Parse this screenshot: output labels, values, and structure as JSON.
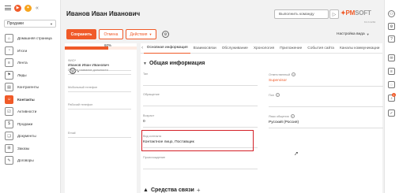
{
  "sidebar": {
    "workspace": "Продажи",
    "items": [
      {
        "label": "Домашняя страница",
        "icon": "home-icon",
        "glyph": "⌂"
      },
      {
        "label": "Итоги",
        "icon": "chart-icon",
        "glyph": "◔"
      },
      {
        "label": "Лента",
        "icon": "feed-icon",
        "glyph": "≡"
      },
      {
        "label": "Лиды",
        "icon": "lead-icon",
        "glyph": "⚑"
      },
      {
        "label": "Контрагенты",
        "icon": "accounts-icon",
        "glyph": "▤"
      },
      {
        "label": "Контакты",
        "icon": "contacts-icon",
        "glyph": "☺"
      },
      {
        "label": "Активности",
        "icon": "activities-icon",
        "glyph": "☑"
      },
      {
        "label": "Продажи",
        "icon": "sales-icon",
        "glyph": "$"
      },
      {
        "label": "Документы",
        "icon": "documents-icon",
        "glyph": "❑"
      },
      {
        "label": "Заказы",
        "icon": "orders-icon",
        "glyph": "⊞"
      },
      {
        "label": "Договоры",
        "icon": "contracts-icon",
        "glyph": "✎"
      }
    ],
    "active_index": 5
  },
  "header": {
    "title": "Иванов Иван Иванович",
    "command_placeholder": "Выполнить команду",
    "logo_a": "✦",
    "logo_b": "PM",
    "logo_c": "SOFT",
    "version": "8.0.6.3284"
  },
  "toolbar": {
    "save": "Сохранить",
    "cancel": "Отмена",
    "actions": "Действия",
    "view_settings": "Настройка вида"
  },
  "profile": {
    "completeness_value": 0.6,
    "completeness_label": "60%",
    "fields": [
      {
        "label": "ФИО*",
        "value": "Иванов Иван Иванович"
      },
      {
        "label": "Полное название должности",
        "value": ""
      },
      {
        "label": "Мобильный телефон",
        "value": ""
      },
      {
        "label": "Рабочий телефон",
        "value": ""
      },
      {
        "label": "Email",
        "value": ""
      }
    ]
  },
  "tabs": [
    "Основная информация",
    "Взаимосвязи",
    "Обслуживание",
    "Хронология",
    "Приложение",
    "События сайта",
    "Каналы коммуникации"
  ],
  "tabs_active": 0,
  "section_main": {
    "title": "Общая информация",
    "fields_left": [
      {
        "label": "Тип",
        "value": ""
      },
      {
        "label": "Обращение",
        "value": ""
      },
      {
        "label": "Возраст",
        "value": "0"
      },
      {
        "label": "Вид контакта",
        "value": "Контактное лицо, Поставщик"
      },
      {
        "label": "Происхождение",
        "value": ""
      }
    ],
    "fields_right": [
      {
        "label": "Ответственный",
        "value": "Supervisor",
        "link": true
      },
      {
        "label": "Пол",
        "value": ""
      },
      {
        "label": "Язык общения",
        "value": "Русский (Россия)"
      }
    ]
  },
  "section_contacts": {
    "title": "Средства связи"
  },
  "accent_color": "#f05a28",
  "highlight_color": "#d42027"
}
